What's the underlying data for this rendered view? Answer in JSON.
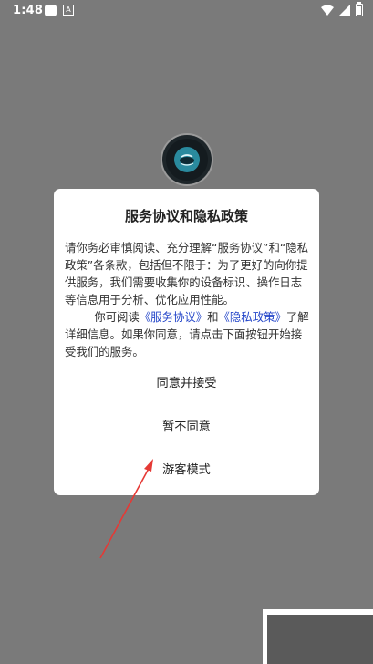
{
  "status_bar": {
    "time": "1:48",
    "notif_a": "A"
  },
  "dialog": {
    "title": "服务协议和隐私政策",
    "para1": "请你务必审慎阅读、充分理解“服务协议”和“隐私政策”各条款，包括但不限于：为了更好的向你提供服务，我们需要收集你的设备标识、操作日志等信息用于分析、优化应用性能。",
    "para2_prefix": "你可阅读",
    "link_service": "《服务协议》",
    "and": "和",
    "link_privacy": "《隐私政策》",
    "para2_suffix": "了解详细信息。如果你同意，请点击下面按钮开始接受我们的服务。",
    "accept_label": "同意并接受",
    "decline_label": "暂不同意",
    "guest_label": "游客模式"
  },
  "annotation": {
    "arrow_color": "#e53935"
  },
  "colors": {
    "overlay": "#7a7a7a",
    "link": "#2446c9"
  }
}
